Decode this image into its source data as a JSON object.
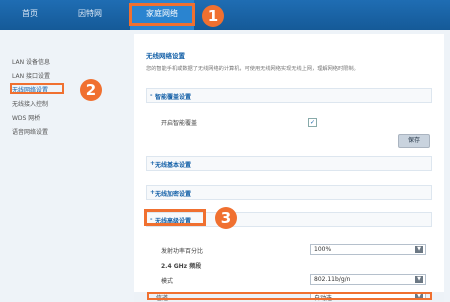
{
  "nav": {
    "tabs": [
      {
        "label": "首页"
      },
      {
        "label": "因特网"
      },
      {
        "label": "家庭网络"
      }
    ]
  },
  "sidebar": {
    "items": [
      {
        "label": "LAN 设备信息"
      },
      {
        "label": "LAN 接口设置"
      },
      {
        "label": "无线网络设置"
      },
      {
        "label": "无线接入控制"
      },
      {
        "label": "WDS 网桥"
      },
      {
        "label": "语音网络设置"
      }
    ]
  },
  "callouts": [
    "1",
    "2",
    "3"
  ],
  "main": {
    "title": "无线网络设置",
    "description": "您的智能手机或数据了无线网络的计算机，可使用无线网络实现无线上网，理解网络时限制。",
    "sections": {
      "smart": {
        "label": "智能覆盖设置",
        "toggle": "-"
      },
      "basic": {
        "label": "无线基本设置",
        "toggle": "+"
      },
      "security": {
        "label": "无线加密设置",
        "toggle": "+"
      },
      "advanced": {
        "label": "无线高级设置",
        "toggle": "-"
      }
    },
    "smart_coverage": {
      "enable_label": "开启智能覆盖",
      "checked": "✓",
      "save_label": "保存"
    },
    "advanced": {
      "tx_power_label": "发射功率百分比",
      "tx_power_value": "100%",
      "band_title": "2.4 GHz 频段",
      "mode_label": "模式",
      "mode_value": "802.11b/g/n",
      "channel_label": "信道",
      "channel_value": "自动选"
    }
  }
}
